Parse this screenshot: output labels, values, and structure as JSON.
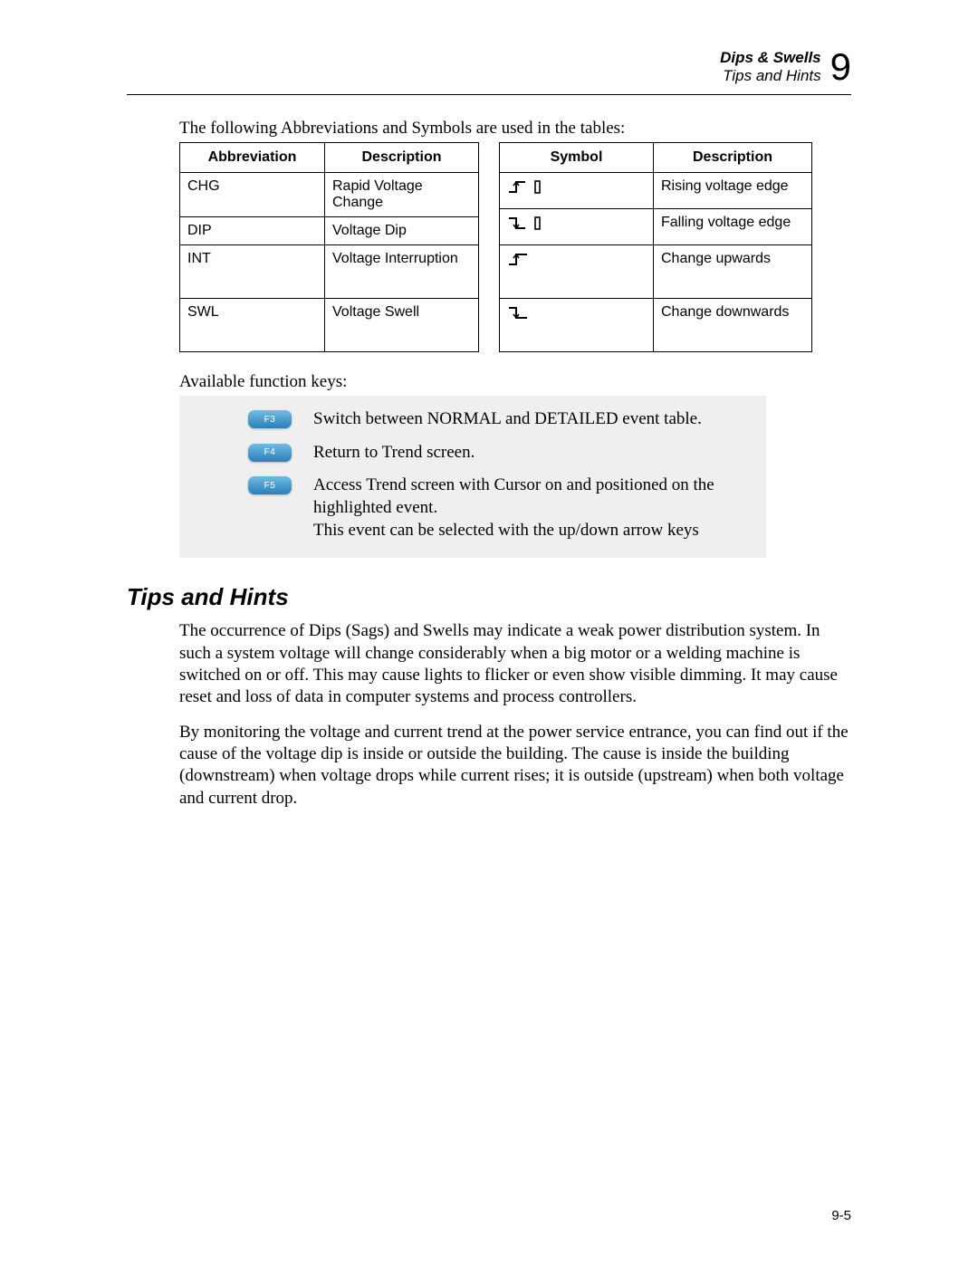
{
  "header": {
    "chapter_title": "Dips & Swells",
    "section_title": "Tips and Hints",
    "chapter_number": "9"
  },
  "intro_line": "The following Abbreviations and Symbols are used in the tables:",
  "abbrev_table": {
    "headers": [
      "Abbreviation",
      "Description"
    ],
    "rows": [
      {
        "abbr": "CHG",
        "desc": "Rapid Voltage Change"
      },
      {
        "abbr": "DIP",
        "desc": "Voltage Dip"
      },
      {
        "abbr": "INT",
        "desc": "Voltage Interruption"
      },
      {
        "abbr": "SWL",
        "desc": "Voltage Swell"
      }
    ]
  },
  "symbol_table": {
    "headers": [
      "Symbol",
      "Description"
    ],
    "rows": [
      {
        "icon": "rising-edge-icon",
        "desc": "Rising voltage edge"
      },
      {
        "icon": "falling-edge-icon",
        "desc": "Falling voltage edge"
      },
      {
        "icon": "change-up-icon",
        "desc": "Change upwards"
      },
      {
        "icon": "change-down-icon",
        "desc": "Change downwards"
      }
    ]
  },
  "fk_caption": "Available function keys:",
  "function_keys": [
    {
      "key": "F3",
      "text": "Switch between NORMAL and DETAILED event table."
    },
    {
      "key": "F4",
      "text": "Return to Trend screen."
    },
    {
      "key": "F5",
      "text": "Access Trend screen with Cursor on and positioned on the highlighted event.\nThis event can be selected with the up/down arrow keys"
    }
  ],
  "section_heading": "Tips and Hints",
  "paragraphs": [
    "The occurrence of Dips (Sags) and Swells may indicate a weak power distribution system. In such a system voltage will change considerably when a big motor or a welding machine is switched on or off. This may cause lights to flicker or even show visible dimming. It may cause reset and loss of data in computer systems and process controllers.",
    "By monitoring the voltage and current trend at the power service entrance, you can find out if the cause of the voltage dip is inside or outside the building. The cause is inside the building (downstream) when voltage drops while current rises; it is outside (upstream) when both voltage and current drop."
  ],
  "page_number": "9-5"
}
